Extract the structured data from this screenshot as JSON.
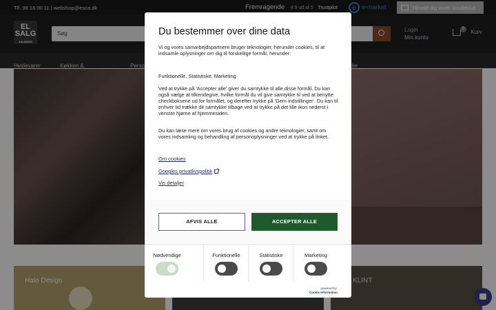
{
  "topbar": {
    "contact": "Tlf. 98 18 00 11 | webshop@esca.dk",
    "rating_word": "Fremragende",
    "rating_score": "4.9 ud af 5",
    "trustpilot": "Trustpilot",
    "emarket": "e-market",
    "club_label": "Tilmeld dig vores kundeklub"
  },
  "header": {
    "logo_text": "EL SALG",
    "logo_sub": "AALBORG",
    "search_placeholder": "Søg",
    "login_top": "Login",
    "login_bottom": "Min konto",
    "cart_label": "Kurv",
    "cart_count": "0"
  },
  "nav": {
    "items": [
      "Hvidevarer",
      "Køkken & madlavning",
      "Perso",
      "der"
    ]
  },
  "cards": {
    "c1_label": "Halo Design",
    "c3_label": "KLINT"
  },
  "consent": {
    "title": "Du bestemmer over dine data",
    "intro": "Vi og vores samarbejdspartnere bruger teknologier, herunder cookies, til at indsamle oplysninger om dig til forskellige formål, herunder:",
    "purposes": "Funktionelle, Statistiske, Marketing",
    "explain": "Ved at trykke på 'Accepter alle' giver du samtykke til alle disse formål. Du kan også vælge at tilkendegive, hvilke formål du vil give samtykke til ved at benytte checkboksene ud for formålet, og derefter trykke på 'Gem indstillinger'. Du kan til enhver tid trække dit samtykke tilbage ved at trykke på det lille ikon nederst i venstre hjørne af hjemmesiden.",
    "more": "Du kan læse mere om vores brug af cookies og andre teknologier, samt om vores indsamling og behandling af personoplysninger ved at trykke på linket.",
    "link_cookies": "Om cookies",
    "link_google": "Googles privatlivspolitik",
    "link_details": "Vis detaljer",
    "reject_label": "AFVIS ALLE",
    "accept_label": "ACCEPTER ALLE",
    "toggles": [
      {
        "label": "Nødvendige",
        "state": "on",
        "disabled": true
      },
      {
        "label": "Funktionelle",
        "state": "off",
        "disabled": false
      },
      {
        "label": "Statistiske",
        "state": "off",
        "disabled": false
      },
      {
        "label": "Marketing",
        "state": "off",
        "disabled": false
      }
    ],
    "powered_by": "powered by:",
    "powered_brand": "Cookie Information"
  },
  "colors": {
    "accept_bg": "#1e5a2b",
    "link": "#1f2a5e",
    "toggle_off": "#4a4a4a",
    "toggle_disabled": "#c9dcc9"
  }
}
